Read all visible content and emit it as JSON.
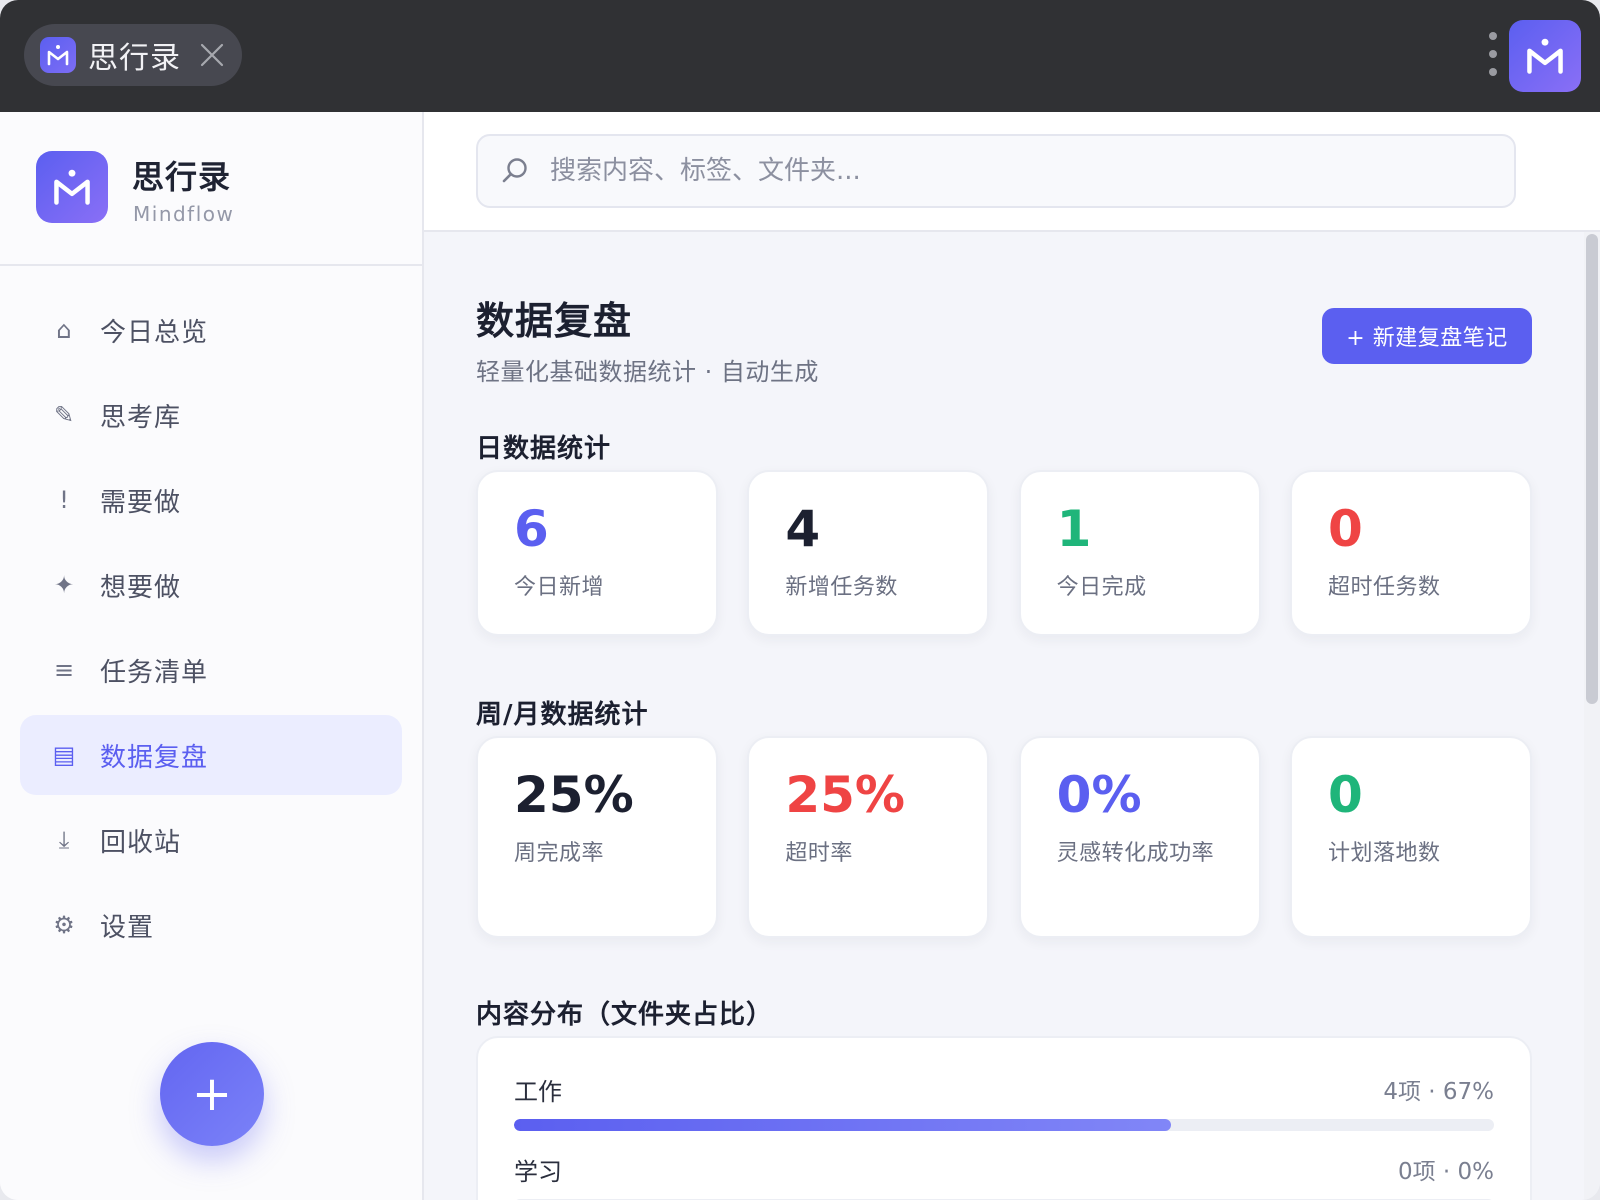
{
  "tab": {
    "title": "思行录"
  },
  "brand": {
    "name": "思行录",
    "sub": "Mindflow"
  },
  "sidebar": {
    "items": [
      {
        "label": "今日总览",
        "icon": "⌂",
        "name": "home-icon"
      },
      {
        "label": "思考库",
        "icon": "✎",
        "name": "pencil-icon"
      },
      {
        "label": "需要做",
        "icon": "!",
        "name": "exclamation-icon"
      },
      {
        "label": "想要做",
        "icon": "✦",
        "name": "sparkle-icon"
      },
      {
        "label": "任务清单",
        "icon": "≡",
        "name": "list-icon"
      },
      {
        "label": "数据复盘",
        "icon": "▤",
        "name": "report-icon"
      },
      {
        "label": "回收站",
        "icon": "⤓",
        "name": "trash-download-icon"
      },
      {
        "label": "设置",
        "icon": "⚙",
        "name": "gear-icon"
      }
    ],
    "active_index": 5,
    "fab_label": "+"
  },
  "search": {
    "placeholder": "搜索内容、标签、文件夹..."
  },
  "page": {
    "title": "数据复盘",
    "subtitle": "轻量化基础数据统计 · 自动生成",
    "new_button": "+ 新建复盘笔记"
  },
  "daily": {
    "title": "日数据统计",
    "cards": [
      {
        "value": "6",
        "label": "今日新增",
        "color": "#5b5ff0"
      },
      {
        "value": "4",
        "label": "新增任务数",
        "color": "#1c2030"
      },
      {
        "value": "1",
        "label": "今日完成",
        "color": "#1fb57a"
      },
      {
        "value": "0",
        "label": "超时任务数",
        "color": "#ef4444"
      }
    ]
  },
  "weekly": {
    "title": "周/月数据统计",
    "cards": [
      {
        "value": "25%",
        "label": "周完成率",
        "color": "#1c2030"
      },
      {
        "value": "25%",
        "label": "超时率",
        "color": "#ef4444"
      },
      {
        "value": "0%",
        "label": "灵感转化成功率",
        "color": "#5b5ff0"
      },
      {
        "value": "0",
        "label": "计划落地数",
        "color": "#1fb57a"
      }
    ]
  },
  "distribution": {
    "title": "内容分布（文件夹占比）",
    "rows": [
      {
        "label": "工作",
        "meta": "4项 · 67%",
        "percent": 67
      },
      {
        "label": "学习",
        "meta": "0项 · 0%",
        "percent": 0
      }
    ]
  },
  "colors": {
    "accent": "#5b5ff0",
    "danger": "#ef4444",
    "success": "#1fb57a"
  }
}
